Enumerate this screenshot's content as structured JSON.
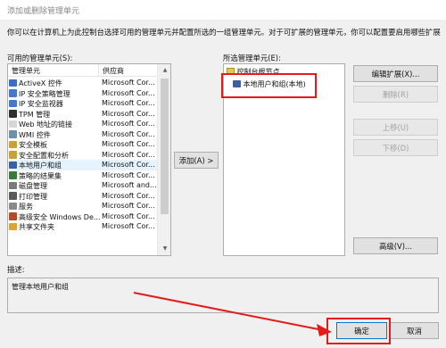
{
  "window": {
    "title": "添加或删除管理单元"
  },
  "intro_text": "你可以在计算机上为此控制台选择可用的管理单元并配置所选的一组管理单元。对于可扩展的管理单元，你可以配置要启用哪些扩展项。",
  "available": {
    "label": "可用的管理单元(S):",
    "col_snapin": "管理单元",
    "col_vendor": "供应商",
    "items": [
      {
        "name": "ActiveX 控件",
        "vendor": "Microsoft Cor...",
        "icon": "activex-icon",
        "color": "#3a6fc4"
      },
      {
        "name": "IP 安全策略管理",
        "vendor": "Microsoft Cor...",
        "icon": "ip-security-policy-icon",
        "color": "#4a78c8"
      },
      {
        "name": "IP 安全监视器",
        "vendor": "Microsoft Cor...",
        "icon": "ip-security-monitor-icon",
        "color": "#4a78c8"
      },
      {
        "name": "TPM 管理",
        "vendor": "Microsoft Cor...",
        "icon": "tpm-icon",
        "color": "#2f2f2f"
      },
      {
        "name": "Web 地址的链接",
        "vendor": "Microsoft Cor...",
        "icon": "web-link-icon",
        "color": "#d6d6d6"
      },
      {
        "name": "WMI 控件",
        "vendor": "Microsoft Cor...",
        "icon": "wmi-icon",
        "color": "#6f8fa8"
      },
      {
        "name": "安全模板",
        "vendor": "Microsoft Cor...",
        "icon": "security-template-icon",
        "color": "#c9a13a"
      },
      {
        "name": "安全配置和分析",
        "vendor": "Microsoft Cor...",
        "icon": "security-config-icon",
        "color": "#c9a13a"
      },
      {
        "name": "本地用户和组",
        "vendor": "Microsoft Cor...",
        "icon": "local-users-icon",
        "color": "#3a5fa8"
      },
      {
        "name": "策略的结果集",
        "vendor": "Microsoft Cor...",
        "icon": "policy-result-icon",
        "color": "#3a7a3a"
      },
      {
        "name": "磁盘管理",
        "vendor": "Microsoft and...",
        "icon": "disk-management-icon",
        "color": "#7a7a7a"
      },
      {
        "name": "打印管理",
        "vendor": "Microsoft Cor...",
        "icon": "print-management-icon",
        "color": "#5a5a5a"
      },
      {
        "name": "服务",
        "vendor": "Microsoft Cor...",
        "icon": "services-icon",
        "color": "#8a8a8a"
      },
      {
        "name": "高级安全 Windows De...",
        "vendor": "Microsoft Cor...",
        "icon": "firewall-icon",
        "color": "#b34a2a"
      },
      {
        "name": "共享文件夹",
        "vendor": "Microsoft Cor...",
        "icon": "shared-folder-icon",
        "color": "#d9a53a"
      }
    ]
  },
  "add_button": "添加(A) >",
  "selected": {
    "label": "所选管理单元(E):",
    "root": "控制台根节点",
    "child": "本地用户和组(本地)"
  },
  "buttons": {
    "edit_extensions": "编辑扩展(X)...",
    "remove": "删除(R)",
    "move_up": "上移(U)",
    "move_down": "下移(D)",
    "advanced": "高级(V)...",
    "ok": "确定",
    "cancel": "取消"
  },
  "description": {
    "label": "描述:",
    "text": "管理本地用户和组"
  },
  "colors": {
    "annotation_red": "#e51a1a",
    "selected_row": "#e5f3ff"
  }
}
